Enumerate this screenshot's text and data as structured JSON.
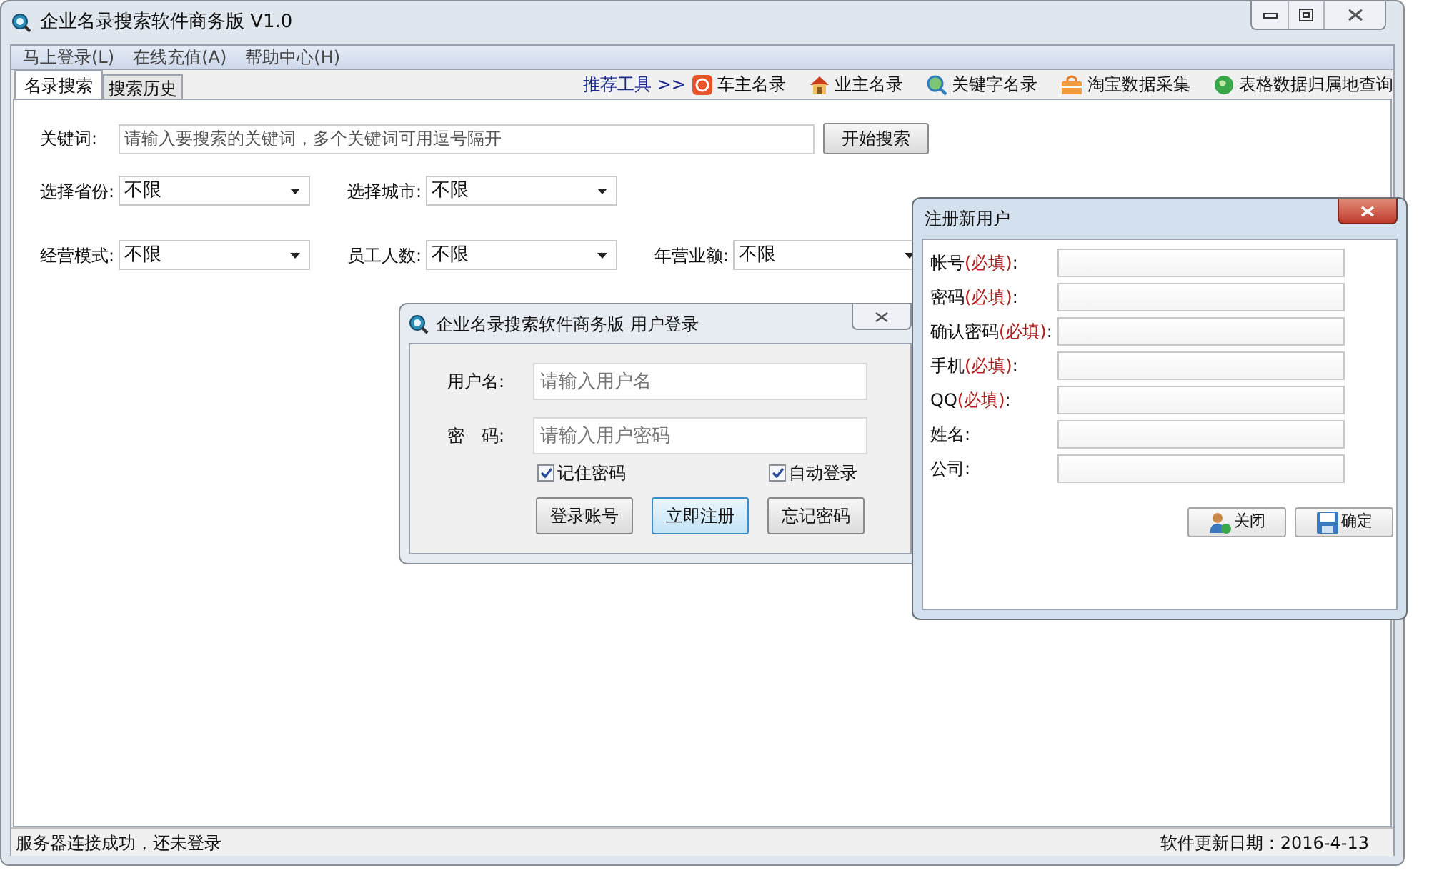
{
  "main_window": {
    "title": "企业名录搜索软件商务版 V1.0",
    "menu": [
      "马上登录(L)",
      "在线充值(A)",
      "帮助中心(H)"
    ],
    "tabs": [
      {
        "label": "名录搜索",
        "selected": true
      },
      {
        "label": "搜索历史",
        "selected": false
      }
    ],
    "tools_label": "推荐工具 >>",
    "tools": [
      {
        "label": "车主名录",
        "kind": "car"
      },
      {
        "label": "业主名录",
        "kind": "house"
      },
      {
        "label": "关键字名录",
        "kind": "search"
      },
      {
        "label": "淘宝数据采集",
        "kind": "bag"
      },
      {
        "label": "表格数据归属地查询",
        "kind": "globe"
      }
    ],
    "keyword": {
      "label": "关键词:",
      "placeholder": "请输入要搜索的关键词，多个关键词可用逗号隔开"
    },
    "search_button": "开始搜索",
    "filter_rows": [
      [
        {
          "label": "选择省份:",
          "value": "不限"
        },
        {
          "label": "选择城市:",
          "value": "不限"
        }
      ],
      [
        {
          "label": "经营模式:",
          "value": "不限"
        },
        {
          "label": "员工人数:",
          "value": "不限"
        },
        {
          "label": "年营业额:",
          "value": "不限"
        }
      ]
    ],
    "status_bar": {
      "left": "服务器连接成功，还未登录",
      "right": "软件更新日期：2016-4-13"
    }
  },
  "login_dialog": {
    "title": "企业名录搜索软件商务版 用户登录",
    "fields": [
      {
        "label": "用户名:",
        "placeholder": "请输入用户名"
      },
      {
        "label": "密　码:",
        "placeholder": "请输入用户密码"
      }
    ],
    "checkboxes": [
      {
        "label": "记住密码",
        "checked": true
      },
      {
        "label": "自动登录",
        "checked": true
      }
    ],
    "buttons": [
      {
        "label": "登录账号",
        "selected": false
      },
      {
        "label": "立即注册",
        "selected": true
      },
      {
        "label": "忘记密码",
        "selected": false
      }
    ]
  },
  "register_dialog": {
    "title": "注册新用户",
    "fields": [
      {
        "label": "帐号",
        "note": "(必填)",
        "tail": ":"
      },
      {
        "label": "密码",
        "note": "(必填)",
        "tail": ":"
      },
      {
        "label": "确认密码",
        "note": "(必填)",
        "tail": ":"
      },
      {
        "label": "手机",
        "note": "(必填)",
        "tail": ":"
      },
      {
        "label": "QQ",
        "note": "(必填)",
        "tail": ":"
      },
      {
        "label": "姓名:"
      },
      {
        "label": "公司:"
      }
    ],
    "buttons": [
      {
        "label": "关闭",
        "kind": "person"
      },
      {
        "label": "确定",
        "kind": "save"
      }
    ]
  }
}
